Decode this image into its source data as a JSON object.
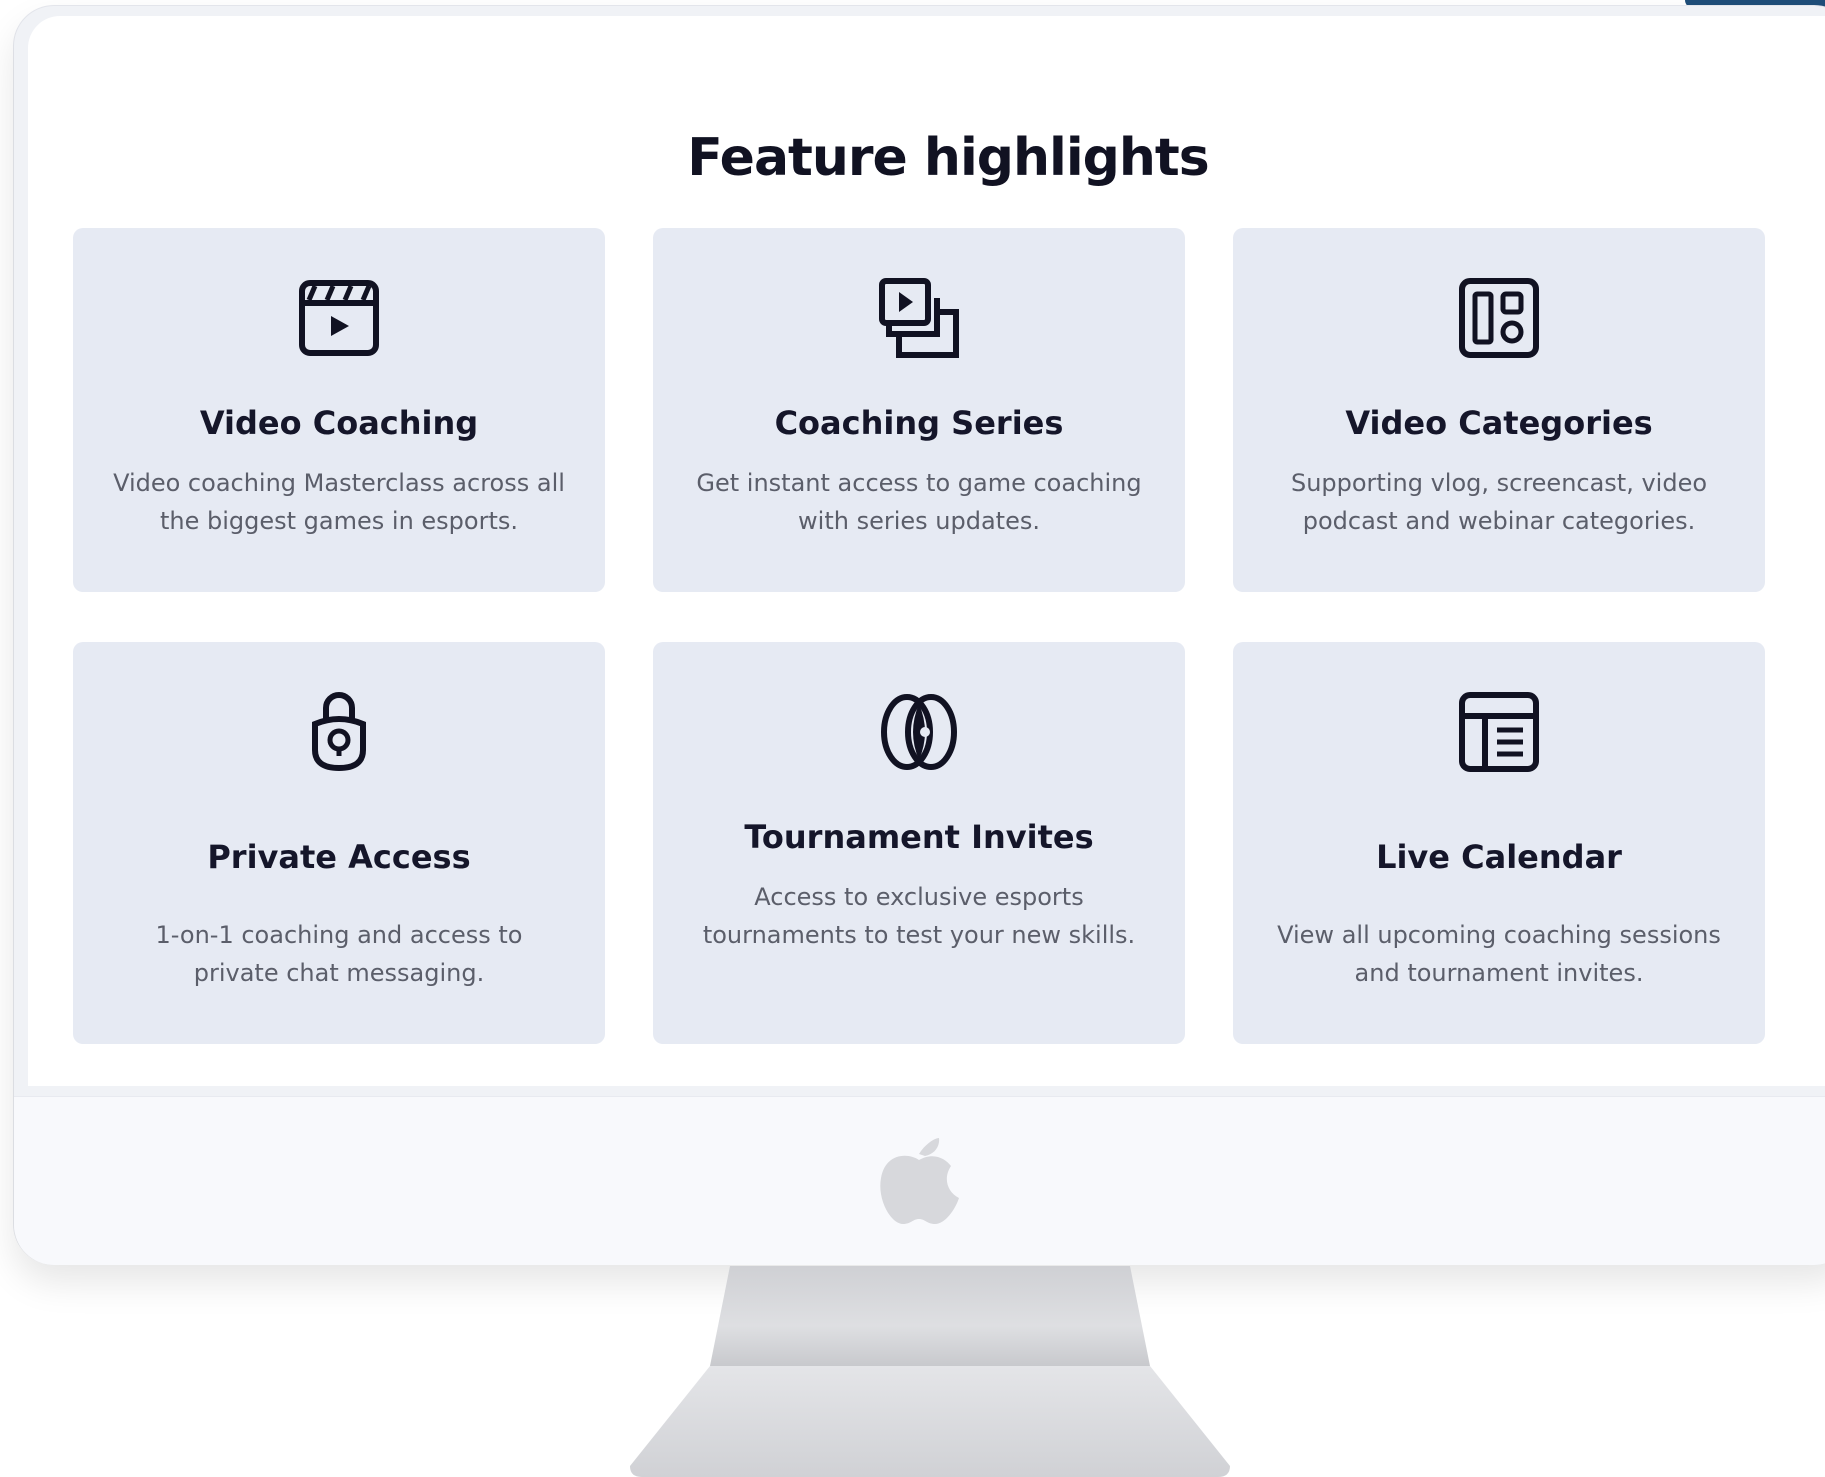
{
  "page": {
    "title": "Feature highlights"
  },
  "cards": [
    {
      "title": "Video Coaching",
      "description": "Video coaching Masterclass across all the biggest games in esports.",
      "icon": "video-clapper-icon"
    },
    {
      "title": "Coaching Series",
      "description": "Get instant access to game coaching with series updates.",
      "icon": "video-stack-icon"
    },
    {
      "title": "Video Categories",
      "description": "Supporting vlog, screencast, video podcast and webinar categories.",
      "icon": "layout-grid-icon"
    },
    {
      "title": "Private Access",
      "description": "1-on-1 coaching and access to private chat messaging.",
      "icon": "lock-icon"
    },
    {
      "title": "Tournament Invites",
      "description": "Access to exclusive esports tournaments to test your new skills.",
      "icon": "versus-icon"
    },
    {
      "title": "Live Calendar",
      "description": "View all upcoming coaching sessions and tournament invites.",
      "icon": "calendar-layout-icon"
    }
  ],
  "colors": {
    "card_background": "#e6eaf3",
    "title_text": "#111222",
    "body_text": "#5b5e6a",
    "icon_stroke": "#111222"
  }
}
